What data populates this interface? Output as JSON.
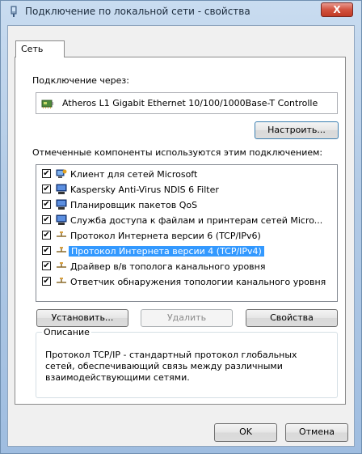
{
  "window": {
    "title": "Подключение по локальной сети - свойства",
    "close_glyph": "X"
  },
  "tabs": [
    {
      "label": "Сеть",
      "active": true
    }
  ],
  "connect_using": {
    "label": "Подключение через:",
    "adapter": "Atheros L1 Gigabit Ethernet 10/100/1000Base-T Controlle",
    "configure_button": "Настроить..."
  },
  "components": {
    "label": "Отмеченные компоненты используются этим подключением:",
    "items": [
      {
        "label": "Клиент для сетей Microsoft",
        "checked": true,
        "icon": "network-client-icon",
        "selected": false
      },
      {
        "label": "Kaspersky Anti-Virus NDIS 6 Filter",
        "checked": true,
        "icon": "network-service-icon",
        "selected": false
      },
      {
        "label": "Планировщик пакетов QoS",
        "checked": true,
        "icon": "network-service-icon",
        "selected": false
      },
      {
        "label": "Служба доступа к файлам и принтерам сетей Micro...",
        "checked": true,
        "icon": "network-service-icon",
        "selected": false
      },
      {
        "label": "Протокол Интернета версии 6 (TCP/IPv6)",
        "checked": true,
        "icon": "protocol-icon",
        "selected": false
      },
      {
        "label": "Протокол Интернета версии 4 (TCP/IPv4)",
        "checked": true,
        "icon": "protocol-icon",
        "selected": true
      },
      {
        "label": "Драйвер в/в тополога канального уровня",
        "checked": true,
        "icon": "protocol-icon",
        "selected": false
      },
      {
        "label": "Ответчик обнаружения топологии канального уровня",
        "checked": true,
        "icon": "protocol-icon",
        "selected": false
      }
    ],
    "check_glyph": "✔"
  },
  "actions": {
    "install": "Установить...",
    "uninstall": "Удалить",
    "properties": "Свойства"
  },
  "description": {
    "title": "Описание",
    "text": "Протокол TCP/IP - стандартный протокол глобальных сетей, обеспечивающий связь между различными взаимодействующими сетями."
  },
  "footer": {
    "ok": "OK",
    "cancel": "Отмена"
  },
  "colors": {
    "selection": "#3399ff",
    "title_gradient": "#b3cbe6",
    "close_button": "#d2523f"
  }
}
